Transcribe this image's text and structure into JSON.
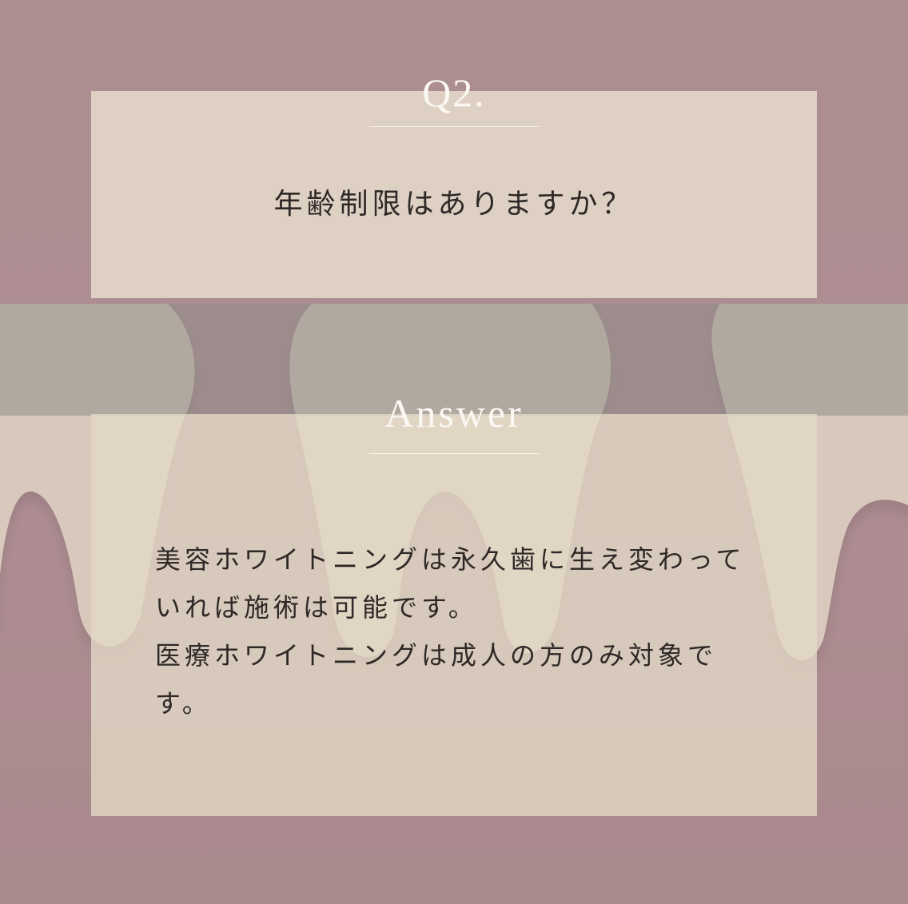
{
  "question": {
    "number": "Q2.",
    "text": "年齢制限はありますか？"
  },
  "answer": {
    "heading": "Answer",
    "lines": [
      "美容ホワイトニングは永久歯に生え変わって",
      "いれば施術は可能です。",
      "医療ホワイトニングは成人の方のみ対象で",
      "す。"
    ]
  },
  "colors": {
    "background": "#ab8e90",
    "card": "#e2d6c8",
    "text": "#2e2826",
    "heading": "#fbf8f3"
  }
}
